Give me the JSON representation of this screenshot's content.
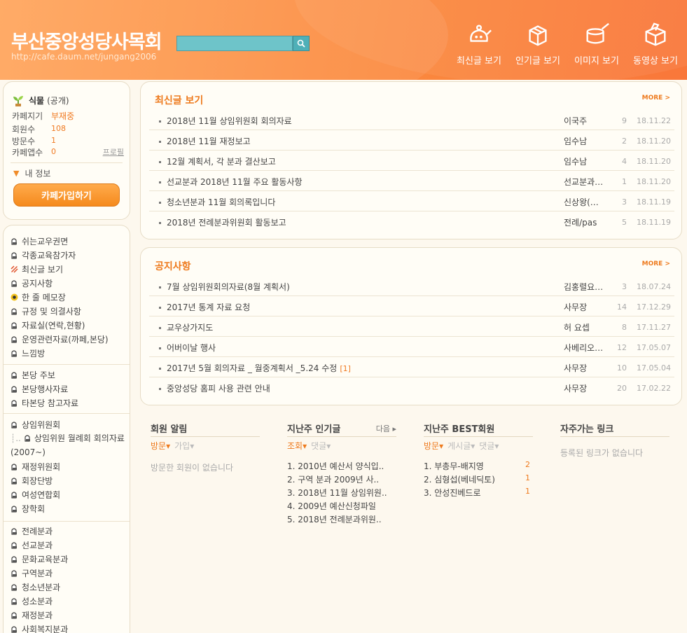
{
  "header": {
    "title": "부산중앙성당사목회",
    "url": "http://cafe.daum.net/jungang2006",
    "nav": [
      {
        "label": "최신글 보기",
        "icon": "kettle-icon"
      },
      {
        "label": "인기글 보기",
        "icon": "box-icon"
      },
      {
        "label": "이미지 보기",
        "icon": "pot-icon"
      },
      {
        "label": "동영상 보기",
        "icon": "package-icon"
      }
    ]
  },
  "profile": {
    "grade": "식물",
    "grade_note": "(공개)",
    "rows": [
      {
        "key": "카페지기",
        "value": "부재중"
      },
      {
        "key": "회원수",
        "value": "108"
      },
      {
        "key": "방문수",
        "value": "1"
      },
      {
        "key": "카페앱수",
        "value": "0"
      }
    ],
    "profile_link": "프로필",
    "my_info": "내 정보",
    "join_button": "카페가입하기"
  },
  "menu_groups": [
    [
      "쉬는교우권면",
      "각종교육참가자",
      "최신글 보기",
      "공지사항",
      "한 줄 메모장",
      "규정 및 의결사항",
      "자료실(연락,현황)",
      "운영관련자료(까페,본당)",
      "느낌방"
    ],
    [
      "본당 주보",
      "본당행사자료",
      "타본당 참고자료"
    ],
    [
      "상임위원회",
      "상임위원 월례회 회의자료(2007~)",
      "재정위원회",
      "회장단방",
      "여성연합회",
      "장학회"
    ],
    [
      "전례분과",
      "선교분과",
      "문화교육분과",
      "구역분과",
      "청소년분과",
      "성소분과",
      "재정분과",
      "사회복지분과"
    ]
  ],
  "latest": {
    "title": "최신글 보기",
    "more": "MORE >",
    "rows": [
      {
        "title": "2018년 11월 상임위원회 회의자료",
        "author": "이국주",
        "count": "9",
        "date": "18.11.22"
      },
      {
        "title": "2018년 11월 재정보고",
        "author": "임수남",
        "count": "2",
        "date": "18.11.20"
      },
      {
        "title": "12월 계획서, 각 분과 결산보고",
        "author": "임수남",
        "count": "4",
        "date": "18.11.20"
      },
      {
        "title": "선교분과 2018년 11월 주요 활동사항",
        "author": "선교분과…",
        "count": "1",
        "date": "18.11.20"
      },
      {
        "title": "청소년분과 11월 회의록입니다",
        "author": "신상왕(…",
        "count": "3",
        "date": "18.11.19"
      },
      {
        "title": "2018년 전례분과위원회 활동보고",
        "author": "전례/pas",
        "count": "5",
        "date": "18.11.19"
      }
    ]
  },
  "notice": {
    "title": "공지사항",
    "more": "MORE >",
    "rows": [
      {
        "title": "7월 상임위원회의자료(8월 계획서)",
        "author": "김홍렬요…",
        "count": "3",
        "date": "18.07.24",
        "comments": ""
      },
      {
        "title": "2017년 통계 자료 요청",
        "author": "사무장",
        "count": "14",
        "date": "17.12.29",
        "comments": ""
      },
      {
        "title": "교우상가지도",
        "author": "허 요셉",
        "count": "8",
        "date": "17.11.27",
        "comments": ""
      },
      {
        "title": "어버이날 행사",
        "author": "사베리오…",
        "count": "12",
        "date": "17.05.07",
        "comments": ""
      },
      {
        "title": "2017년 5월 회의자료 _ 월중계획서 _5.24 수정",
        "author": "사무장",
        "count": "10",
        "date": "17.05.04",
        "comments": "[1]"
      },
      {
        "title": "중앙성당 홈피 사용 관련 안내",
        "author": "사무장",
        "count": "20",
        "date": "17.02.22",
        "comments": ""
      }
    ]
  },
  "member_alert": {
    "title": "회원 알림",
    "tabs": [
      "방문▾",
      "가입▾"
    ],
    "empty": "방문한 회원이 없습니다"
  },
  "popular": {
    "title": "지난주 인기글",
    "next": "다음 ▸",
    "tabs": [
      "조회▾",
      "댓글▾"
    ],
    "items": [
      "1. 2010년 예산서 양식입..",
      "2. 구역 분과 2009년 사..",
      "3. 2018년 11월 상임위원..",
      "4. 2009년 예산신청파일",
      "5. 2018년 전례분과위원.."
    ]
  },
  "best_members": {
    "title": "지난주 BEST회원",
    "tabs": [
      "방문▾",
      "게시글▾",
      "댓글▾"
    ],
    "items": [
      {
        "name": "1. 부총무-배지영",
        "count": "2"
      },
      {
        "name": "2. 심형섭(베네딕토)",
        "count": "1"
      },
      {
        "name": "3. 안성진베드로",
        "count": "1"
      }
    ]
  },
  "links": {
    "title": "자주가는 링크",
    "empty": "등록된 링크가 없습니다"
  },
  "colors": {
    "accent": "#ee7a1d",
    "header": "#fb8a3e",
    "search": "#6ec4c9"
  }
}
